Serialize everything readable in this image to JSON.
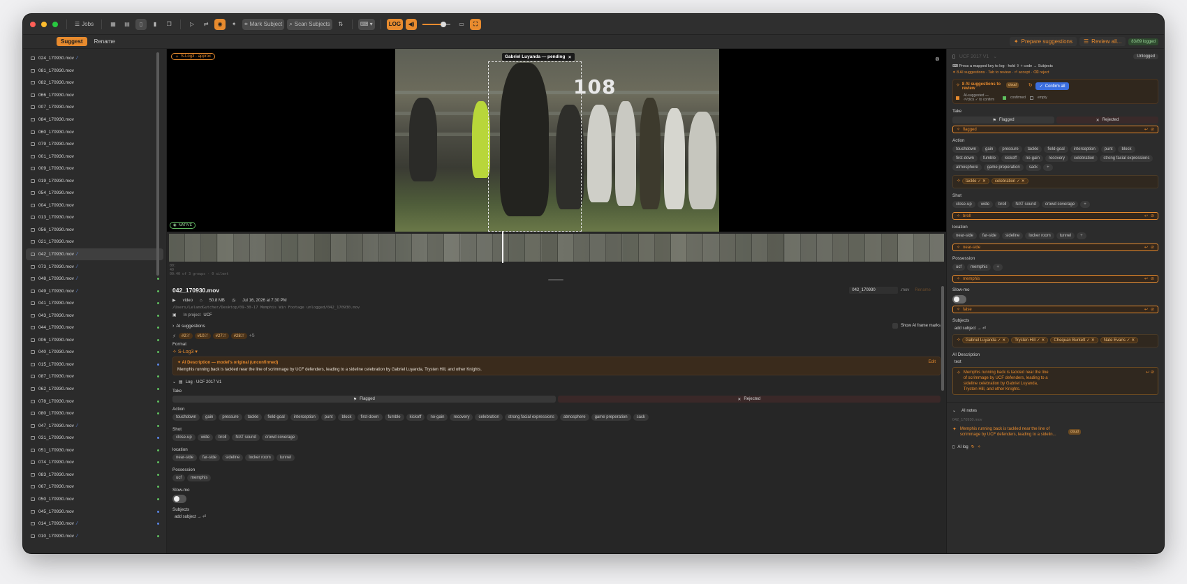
{
  "toolbar": {
    "jobs_label": "Jobs",
    "mark_subject": "Mark Subject",
    "scan_subjects": "Scan Subjects",
    "log_label": "LOG"
  },
  "subbar": {
    "suggest": "Suggest",
    "rename": "Rename",
    "prepare": "Prepare suggestions",
    "review": "Review all...",
    "logged_badge": "83/89 logged"
  },
  "files": [
    {
      "name": "024_170930.mov",
      "slash": true,
      "dot": "#5fbf5f"
    },
    {
      "name": "081_170930.mov",
      "slash": false,
      "dot": "#5fbf5f"
    },
    {
      "name": "082_170930.mov",
      "slash": false,
      "dot": "#5fbf5f"
    },
    {
      "name": "066_170930.mov",
      "slash": false,
      "dot": "#5fbf5f"
    },
    {
      "name": "007_170930.mov",
      "slash": false,
      "dot": "#5fbf5f"
    },
    {
      "name": "084_170930.mov",
      "slash": false,
      "dot": "#5fbf5f"
    },
    {
      "name": "060_170930.mov",
      "slash": false,
      "dot": "#5fbf5f"
    },
    {
      "name": "079_170930.mov",
      "slash": false,
      "dot": "#5fbf5f"
    },
    {
      "name": "001_170930.mov",
      "slash": false,
      "dot": "#5fbf5f"
    },
    {
      "name": "009_170930.mov",
      "slash": false,
      "dot": "#5fbf5f"
    },
    {
      "name": "019_170930.mov",
      "slash": false,
      "dot": "#5fbf5f"
    },
    {
      "name": "054_170930.mov",
      "slash": false,
      "dot": "#5b86e6"
    },
    {
      "name": "004_170930.mov",
      "slash": false,
      "dot": "#5fbf5f"
    },
    {
      "name": "013_170930.mov",
      "slash": false,
      "dot": "#5fbf5f"
    },
    {
      "name": "056_170930.mov",
      "slash": false,
      "dot": "#5fbf5f"
    },
    {
      "name": "021_170930.mov",
      "slash": false,
      "dot": "#5fbf5f"
    },
    {
      "name": "042_170930.mov",
      "slash": true,
      "dot": "",
      "selected": true
    },
    {
      "name": "073_170930.mov",
      "slash": true,
      "dot": "#5fbf5f"
    },
    {
      "name": "048_170930.mov",
      "slash": true,
      "dot": "#5fbf5f"
    },
    {
      "name": "049_170930.mov",
      "slash": true,
      "dot": "#5fbf5f"
    },
    {
      "name": "041_170930.mov",
      "slash": false,
      "dot": "#5fbf5f"
    },
    {
      "name": "043_170930.mov",
      "slash": false,
      "dot": "#5fbf5f"
    },
    {
      "name": "044_170930.mov",
      "slash": false,
      "dot": "#5fbf5f"
    },
    {
      "name": "006_170930.mov",
      "slash": false,
      "dot": "#5fbf5f"
    },
    {
      "name": "040_170930.mov",
      "slash": false,
      "dot": "#5fbf5f"
    },
    {
      "name": "015_170930.mov",
      "slash": false,
      "dot": "#5b86e6"
    },
    {
      "name": "087_170930.mov",
      "slash": false,
      "dot": "#5fbf5f"
    },
    {
      "name": "062_170930.mov",
      "slash": false,
      "dot": "#5fbf5f"
    },
    {
      "name": "078_170930.mov",
      "slash": false,
      "dot": "#5fbf5f"
    },
    {
      "name": "080_170930.mov",
      "slash": false,
      "dot": "#5fbf5f"
    },
    {
      "name": "047_170930.mov",
      "slash": true,
      "dot": "#5fbf5f"
    },
    {
      "name": "031_170930.mov",
      "slash": false,
      "dot": "#5b86e6"
    },
    {
      "name": "051_170930.mov",
      "slash": false,
      "dot": "#5fbf5f"
    },
    {
      "name": "074_170930.mov",
      "slash": false,
      "dot": "#5fbf5f"
    },
    {
      "name": "083_170930.mov",
      "slash": false,
      "dot": "#5fbf5f"
    },
    {
      "name": "067_170930.mov",
      "slash": false,
      "dot": "#5fbf5f"
    },
    {
      "name": "050_170930.mov",
      "slash": false,
      "dot": "#5fbf5f"
    },
    {
      "name": "045_170930.mov",
      "slash": false,
      "dot": "#5b86e6"
    },
    {
      "name": "014_170930.mov",
      "slash": true,
      "dot": "#5b86e6"
    },
    {
      "name": "010_170930.mov",
      "slash": true,
      "dot": "#5fbf5f"
    }
  ],
  "video": {
    "slog_tag": "S-Log3 · approx",
    "pending_tag": "Gabriel Luyanda — pending",
    "native_tag": "NATIVE",
    "sign_number": "108",
    "strip_info_1": "00:",
    "strip_info_2": "40",
    "strip_info_3": "00:40 of 3 groups · 0 silent"
  },
  "details": {
    "filename": "042_170930.mov",
    "type": "video",
    "size": "50.8 MB",
    "date": "Jul 16, 2026 at 7:30 PM",
    "path": "/Users/LelandGutcher/Desktop/09-30-17 Memphis Win Footage unlogged/042_170930.mov",
    "project_prefix": "In project",
    "project": "UCF",
    "rename_value": "042_170930",
    "rename_ext": ".mov",
    "rename_btn": "Rename",
    "ai_suggestions": "AI suggestions",
    "show_frame_marks": "Show AI frame marks",
    "jerseys": [
      {
        "n": "#2",
        "c": "3f"
      },
      {
        "n": "#10",
        "c": "2f"
      },
      {
        "n": "#27",
        "c": "2f"
      },
      {
        "n": "#28",
        "c": "2f"
      }
    ],
    "jerseys_more": "+5",
    "format_label": "Format",
    "format_value": "S-Log3",
    "ai_desc_title": "AI Description — model's original (unconfirmed)",
    "ai_desc_text": "Memphis running back is tackled near the line of scrimmage by UCF defenders, leading to a sideline celebration by Gabriel Luyanda, Trysten Hill, and other Knights.",
    "edit": "Edit",
    "log_title": "Log · UCF 2017 V1",
    "take_label": "Take",
    "flagged": "Flagged",
    "rejected": "Rejected",
    "action_label": "Action",
    "action_chips": [
      "touchdown",
      "gain",
      "pressure",
      "tackle",
      "field-goal",
      "interception",
      "punt",
      "block",
      "first-down",
      "fumble",
      "kickoff",
      "no-gain",
      "recovery",
      "celebration",
      "strong facial expressions",
      "atmosphere",
      "game preperation",
      "sack"
    ],
    "shot_label": "Shot",
    "shot_chips": [
      "close-up",
      "wide",
      "broll",
      "NAT sound",
      "crowd coverage"
    ],
    "location_label": "location",
    "location_chips": [
      "near-side",
      "far-side",
      "sideline",
      "locker room",
      "tunnel"
    ],
    "possession_label": "Possession",
    "possession_chips": [
      "ucf",
      "memphis"
    ],
    "slowmo_label": "Slow-mo",
    "subjects_label": "Subjects",
    "add_subject": "add subject → ⏎"
  },
  "inspector": {
    "title": "UCF 2017 V1",
    "unlogged": "Unlogged",
    "hint1": "Press a mapped key to log · hold ⇧ + code → Subjects",
    "hint2": "8 AI suggestions · Tab to review · ⏎ accept · ⌫ reject",
    "ai_count": "8 AI suggestions to review",
    "cloud": "cloud",
    "confirm_all": "Confirm all",
    "legend_ai": "AI-suggested — ⏎/click ✓ to confirm",
    "legend_confirmed": "confirmed",
    "legend_empty": "empty",
    "take_label": "Take",
    "flagged": "Flagged",
    "rejected": "Rejected",
    "take_value": "flagged",
    "action_label": "Action",
    "action_chips": [
      "touchdown",
      "gain",
      "pressure",
      "tackle",
      "field-goal",
      "interception",
      "punt",
      "block",
      "first-down",
      "fumble",
      "kickoff",
      "no-gain",
      "recovery",
      "celebration",
      "strong facial expressions",
      "atmosphere",
      "game preperation",
      "sack"
    ],
    "action_selected": [
      "tackle ✓ ✕",
      "celebration ✓ ✕"
    ],
    "shot_label": "Shot",
    "shot_chips": [
      "close-up",
      "wide",
      "broll",
      "NAT sound",
      "crowd coverage"
    ],
    "shot_value": "broll",
    "location_label": "location",
    "location_chips": [
      "near-side",
      "far-side",
      "sideline",
      "locker room",
      "tunnel"
    ],
    "location_value": "near-side",
    "possession_label": "Possession",
    "possession_chips": [
      "ucf",
      "memphis"
    ],
    "possession_value": "memphis",
    "slowmo_label": "Slow-mo",
    "slowmo_value": "false",
    "subjects_label": "Subjects",
    "add_subject": "add subject → ⏎",
    "subjects": [
      "Gabriel Luyanda ✓ ✕",
      "Trysten Hill ✓ ✕",
      "Chequan Burkett ✓ ✕",
      "Nate Evans ✓ ✕"
    ],
    "ai_desc_label": "AI Description",
    "ai_desc_mode": "text",
    "ai_desc_text": "Memphis running back is tackled near the line of scrimmage by UCF defenders, leading to a sideline celebration by Gabriel Luyanda, Trysten Hill, and other Knights.",
    "ai_notes_label": "AI notes",
    "ai_notes_file": "042_170930.mov",
    "ai_notes_text": "Memphis running back is tackled near the line of scrimmage by UCF defenders, leading to a sidelin...",
    "ai_notes_badge": "cloud",
    "ai_log": "AI log"
  },
  "colors": {
    "accent": "#e88b2e",
    "blue": "#5b86e6",
    "green": "#5fbf5f"
  }
}
